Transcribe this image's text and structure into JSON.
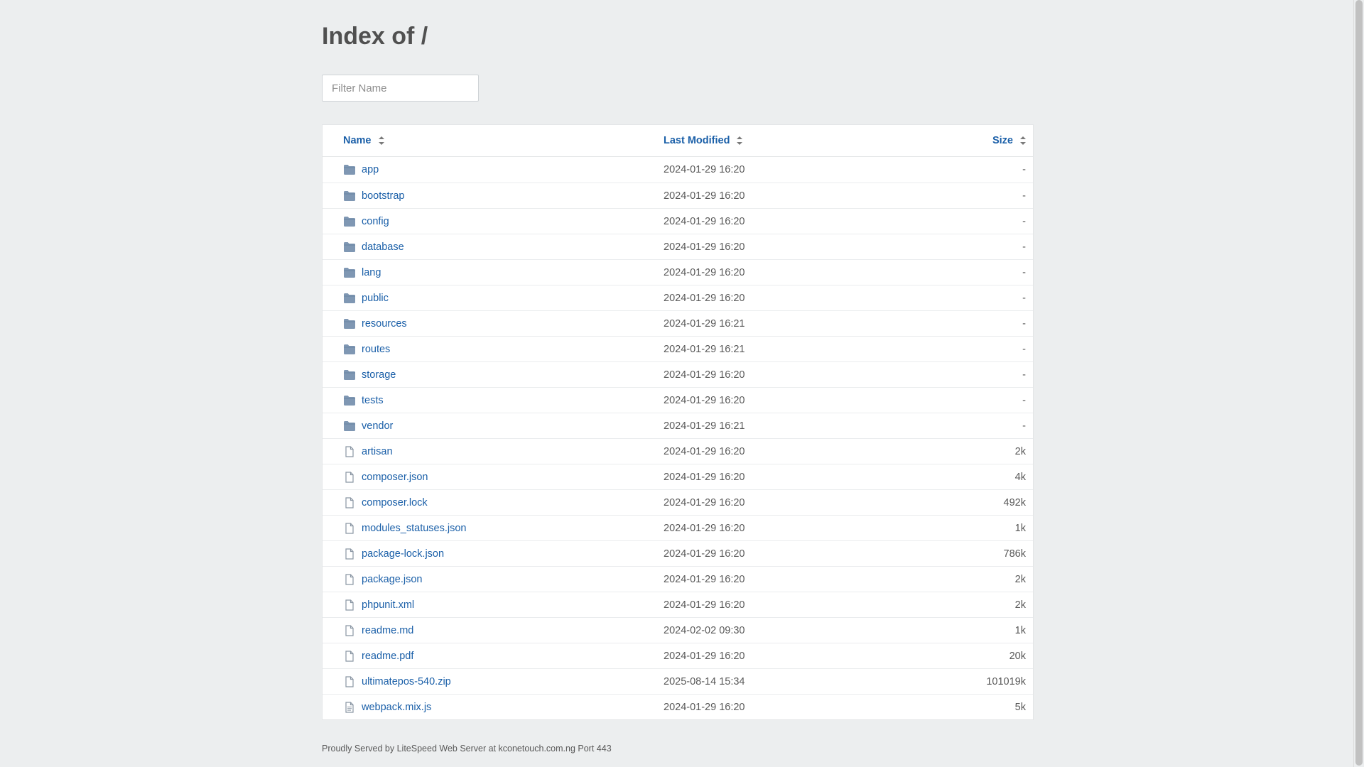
{
  "page": {
    "title": "Index of /"
  },
  "filter": {
    "placeholder": "Filter Name",
    "value": ""
  },
  "columns": {
    "name": "Name",
    "modified": "Last Modified",
    "size": "Size"
  },
  "entries": [
    {
      "name": "app",
      "modified": "2024-01-29 16:20",
      "size": "-",
      "type": "folder"
    },
    {
      "name": "bootstrap",
      "modified": "2024-01-29 16:20",
      "size": "-",
      "type": "folder"
    },
    {
      "name": "config",
      "modified": "2024-01-29 16:20",
      "size": "-",
      "type": "folder"
    },
    {
      "name": "database",
      "modified": "2024-01-29 16:20",
      "size": "-",
      "type": "folder"
    },
    {
      "name": "lang",
      "modified": "2024-01-29 16:20",
      "size": "-",
      "type": "folder"
    },
    {
      "name": "public",
      "modified": "2024-01-29 16:20",
      "size": "-",
      "type": "folder"
    },
    {
      "name": "resources",
      "modified": "2024-01-29 16:21",
      "size": "-",
      "type": "folder"
    },
    {
      "name": "routes",
      "modified": "2024-01-29 16:21",
      "size": "-",
      "type": "folder"
    },
    {
      "name": "storage",
      "modified": "2024-01-29 16:20",
      "size": "-",
      "type": "folder"
    },
    {
      "name": "tests",
      "modified": "2024-01-29 16:20",
      "size": "-",
      "type": "folder"
    },
    {
      "name": "vendor",
      "modified": "2024-01-29 16:21",
      "size": "-",
      "type": "folder"
    },
    {
      "name": "artisan",
      "modified": "2024-01-29 16:20",
      "size": "2k",
      "type": "file"
    },
    {
      "name": "composer.json",
      "modified": "2024-01-29 16:20",
      "size": "4k",
      "type": "file"
    },
    {
      "name": "composer.lock",
      "modified": "2024-01-29 16:20",
      "size": "492k",
      "type": "file"
    },
    {
      "name": "modules_statuses.json",
      "modified": "2024-01-29 16:20",
      "size": "1k",
      "type": "file"
    },
    {
      "name": "package-lock.json",
      "modified": "2024-01-29 16:20",
      "size": "786k",
      "type": "file"
    },
    {
      "name": "package.json",
      "modified": "2024-01-29 16:20",
      "size": "2k",
      "type": "file"
    },
    {
      "name": "phpunit.xml",
      "modified": "2024-01-29 16:20",
      "size": "2k",
      "type": "file"
    },
    {
      "name": "readme.md",
      "modified": "2024-02-02 09:30",
      "size": "1k",
      "type": "file"
    },
    {
      "name": "readme.pdf",
      "modified": "2024-01-29 16:20",
      "size": "20k",
      "type": "file"
    },
    {
      "name": "ultimatepos-540.zip",
      "modified": "2025-08-14 15:34",
      "size": "101019k",
      "type": "file"
    },
    {
      "name": "webpack.mix.js",
      "modified": "2024-01-29 16:20",
      "size": "5k",
      "type": "file-text"
    }
  ],
  "icons": {
    "folder": "folder-icon",
    "file": "file-icon",
    "file-text": "file-text-icon",
    "sort": "sort-icon"
  },
  "colors": {
    "link": "#1a5fa8",
    "folder": "#7f97b3",
    "file": "#8a96a3"
  },
  "footer": {
    "text": "Proudly Served by LiteSpeed Web Server at kconetouch.com.ng Port 443"
  }
}
